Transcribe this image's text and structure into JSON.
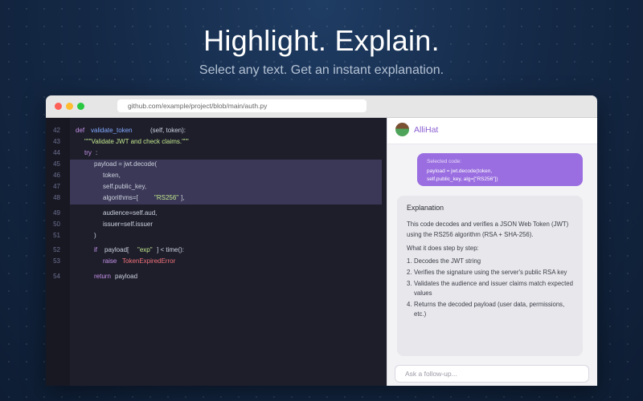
{
  "hero": {
    "title": "Highlight. Explain.",
    "subtitle": "Select any text. Get an instant explanation."
  },
  "browser": {
    "url": "github.com/example/project/blob/main/auth.py"
  },
  "code": {
    "lines": [
      {
        "n": "42"
      },
      {
        "n": "43"
      },
      {
        "n": "44"
      },
      {
        "n": "45"
      },
      {
        "n": "46"
      },
      {
        "n": "47"
      },
      {
        "n": "48"
      },
      {
        "n": "49"
      },
      {
        "n": "50"
      },
      {
        "n": "51"
      },
      {
        "n": "52"
      },
      {
        "n": "53"
      },
      {
        "n": "54"
      }
    ],
    "t": {
      "def": "def",
      "fn_name": "validate_token",
      "sig": "(self, token):",
      "doc": "\"\"\"Validate JWT and check claims.\"\"\"",
      "try": "try",
      "colon": ":",
      "payload_decode": "payload = jwt.decode(",
      "token_arg": "token,",
      "key_arg": "self.public_key,",
      "alg_arg": "algorithms=[",
      "alg_val": "\"RS256\"",
      "alg_close": "],",
      "aud_arg": "audience=self.aud,",
      "iss_arg": "issuer=self.issuer",
      "paren": ")",
      "if": "if",
      "payload_idx": "payload[",
      "exp": "\"exp\"",
      "cmp": "] < time():",
      "raise": "raise",
      "err": "TokenExpiredError",
      "return": "return",
      "ret_val": "payload"
    }
  },
  "panel": {
    "app_name": "AlliHat",
    "selected": {
      "label": "Selected code:",
      "line1": "payload = jwt.decode(token,",
      "line2": "self.public_key, alg=[\"RS256\"])"
    },
    "explanation": {
      "title": "Explanation",
      "body": "This code decodes and verifies a JSON Web Token (JWT) using the RS256 algorithm (RSA + SHA-256).",
      "steps_title": "What it does step by step:",
      "steps": [
        {
          "n": "1.",
          "text": "Decodes the JWT string"
        },
        {
          "n": "2.",
          "text": "Verifies the signature using the server's public RSA key"
        },
        {
          "n": "3.",
          "text": "Validates the audience and issuer claims match expected values"
        },
        {
          "n": "4.",
          "text": "Returns the decoded payload (user data, permissions, etc.)"
        }
      ]
    },
    "followup_placeholder": "Ask a follow-up..."
  }
}
